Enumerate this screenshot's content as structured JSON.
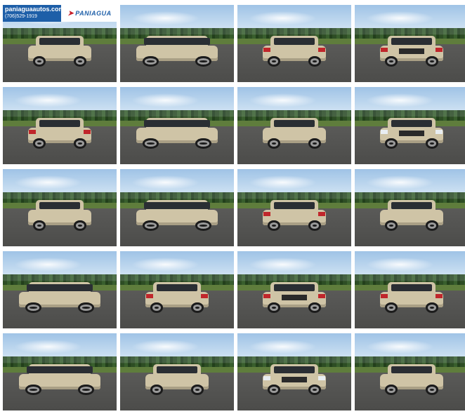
{
  "header": {
    "site_url": "paniaguaautos.com",
    "phone": "(706)529-1919",
    "brand_logo_text": "PANIAGUA"
  },
  "gallery": {
    "vehicle_color": "#cfc4a6",
    "tiles": [
      {
        "view": "front-three-quarter-left"
      },
      {
        "view": "side-right"
      },
      {
        "view": "rear-three-quarter-right"
      },
      {
        "view": "rear"
      },
      {
        "view": "rear-three-quarter-left"
      },
      {
        "view": "side-left"
      },
      {
        "view": "front-three-quarter-left"
      },
      {
        "view": "front"
      },
      {
        "view": "front-three-quarter-left"
      },
      {
        "view": "side-right"
      },
      {
        "view": "rear-three-quarter-right"
      },
      {
        "view": "front-three-quarter-left"
      },
      {
        "view": "side-left"
      },
      {
        "view": "rear-three-quarter-left"
      },
      {
        "view": "rear"
      },
      {
        "view": "rear-three-quarter-left"
      },
      {
        "view": "side-left"
      },
      {
        "view": "front-three-quarter-right"
      },
      {
        "view": "front"
      },
      {
        "view": "front-three-quarter-left"
      }
    ]
  }
}
